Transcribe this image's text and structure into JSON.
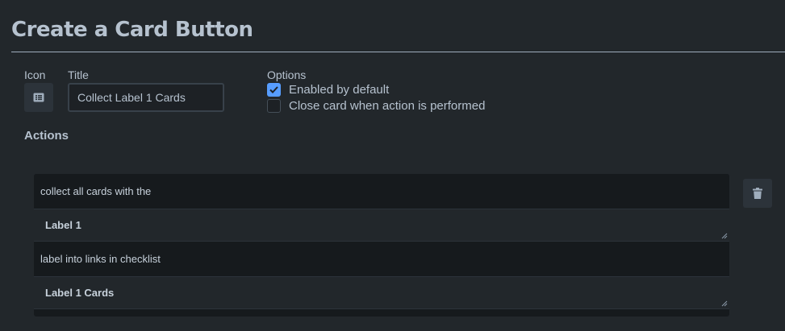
{
  "page": {
    "title": "Create a Card Button"
  },
  "form": {
    "icon_label": "Icon",
    "icon_name": "card-list-icon",
    "title_label": "Title",
    "title_value": "Collect Label 1 Cards",
    "options_label": "Options",
    "options": [
      {
        "label": "Enabled by default",
        "checked": true
      },
      {
        "label": "Close card when action is performed",
        "checked": false
      }
    ]
  },
  "actions": {
    "label": "Actions",
    "segments": {
      "s0": "collect all cards with the",
      "s1": "Label 1",
      "s2": "label into links in checklist",
      "s3": "Label 1 Cards"
    },
    "delete_icon": "trash-icon"
  },
  "colors": {
    "background": "#22272b",
    "accent": "#579dff",
    "text": "#b6c2cf",
    "input_bg": "#1d2125"
  }
}
